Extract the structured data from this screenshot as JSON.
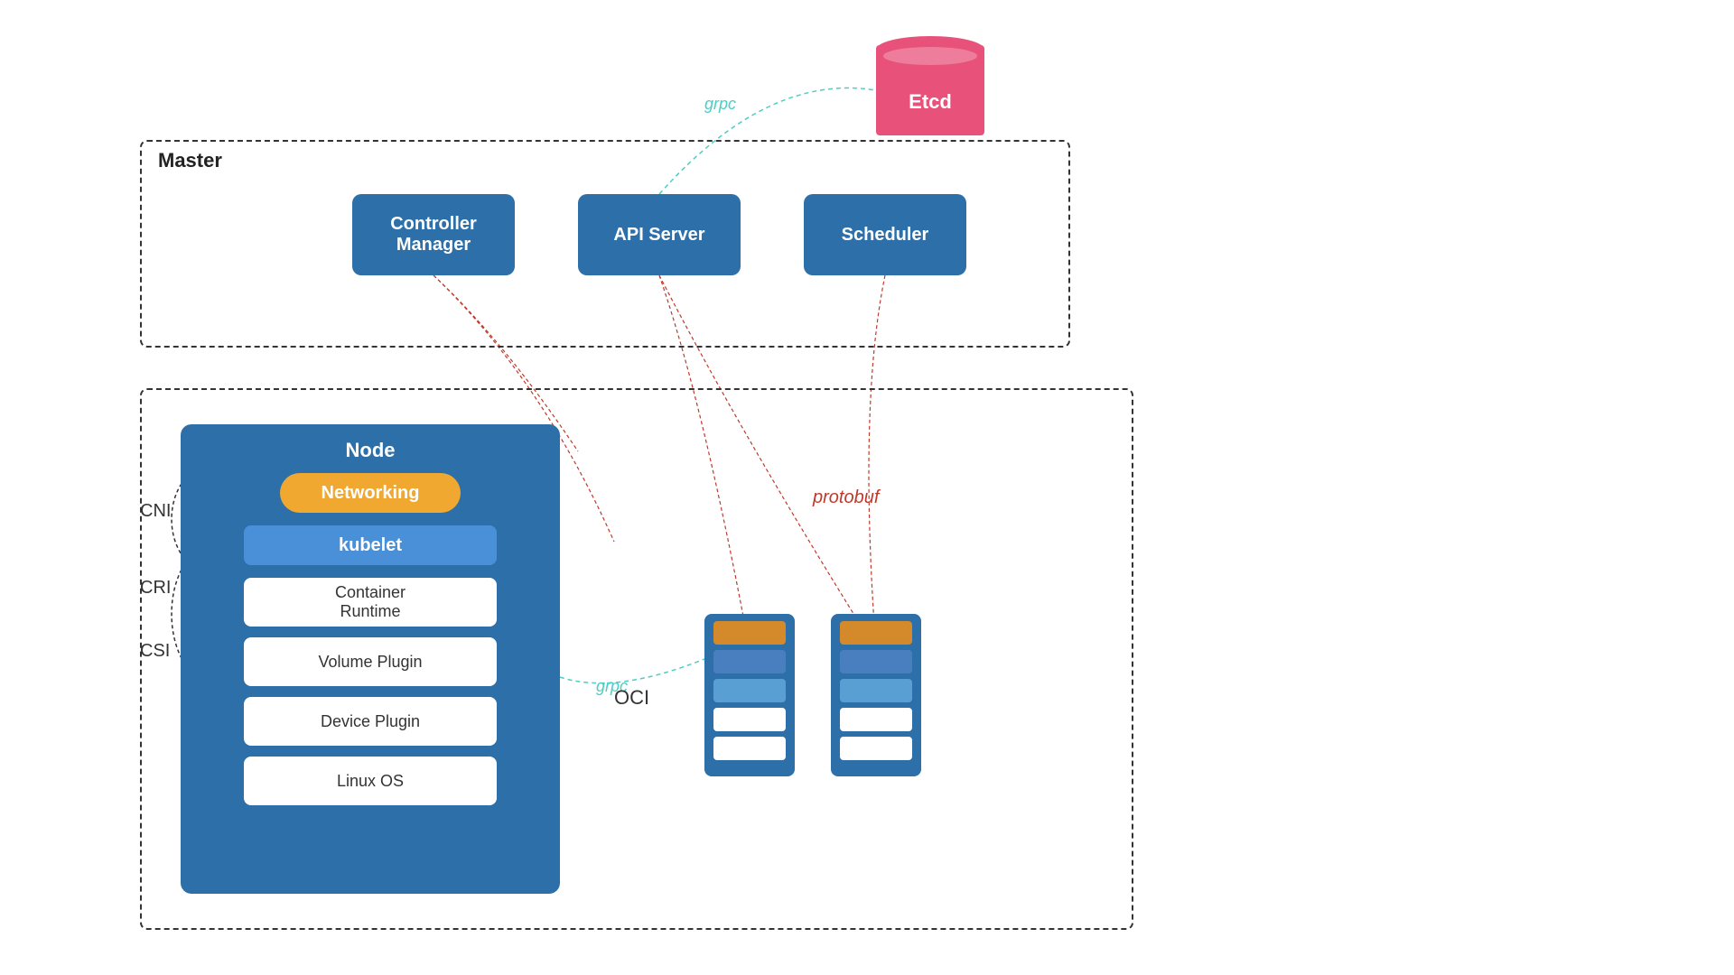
{
  "etcd": {
    "label": "Etcd",
    "color": "#e8527a"
  },
  "grpc_top": "grpc",
  "master": {
    "label": "Master",
    "components": {
      "controller_manager": "Controller\nManager",
      "api_server": "API Server",
      "scheduler": "Scheduler"
    }
  },
  "node": {
    "label": "Node",
    "networking": "Networking",
    "kubelet": "kubelet",
    "container_runtime": "Container\nRuntime",
    "volume_plugin": "Volume Plugin",
    "device_plugin": "Device Plugin",
    "linux_os": "Linux OS"
  },
  "labels": {
    "cni": "CNI",
    "cri": "CRI",
    "csi": "CSI",
    "oci": "OCI",
    "protobuf": "protobuf",
    "grpc_bottom": "grpc"
  }
}
